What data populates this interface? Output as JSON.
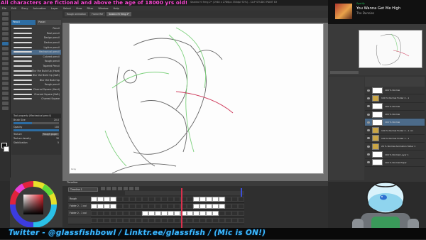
{
  "banner": "All characters are fictional and above the age of 18000 yrs old!",
  "app_title": "Seadra Hi frmg 2* (1948 x 2786px 350dpi 92%) - CLIP STUDIO PAINT EX",
  "menu": [
    "File",
    "Edit",
    "Story",
    "Animation",
    "Layer",
    "Select",
    "View",
    "Filter",
    "Window",
    "Help"
  ],
  "sub_tool_tabs": [
    "Pencil",
    "Pastel"
  ],
  "brushes": [
    {
      "label": "Pencil"
    },
    {
      "label": "Real pencil"
    },
    {
      "label": "Design pencil"
    },
    {
      "label": "Darker pencil"
    },
    {
      "label": "Lighter pencil"
    },
    {
      "label": "Mechanical pencil"
    },
    {
      "label": "Colored pencil"
    },
    {
      "label": "Rough pencil"
    },
    {
      "label": "Tapered Pencil"
    },
    {
      "label": "Blur the Build Up (Hard)"
    },
    {
      "label": "Blur the Build Up (Soft)"
    },
    {
      "label": "Blur the Build Up"
    },
    {
      "label": "Rough pencil"
    },
    {
      "label": "Charred Square (Hard)"
    },
    {
      "label": "Charred Square (Soft)"
    },
    {
      "label": "Charred Square"
    }
  ],
  "tool_property": {
    "header": "Tool property (Mechanical pencil)",
    "brush_size_label": "Brush Size",
    "brush_size": "20.0",
    "opacity_label": "Opacity",
    "opacity": "100",
    "opacity_fraction": 1.0,
    "texture_label": "Texture",
    "texture_value": "Rough paper",
    "texture_density_label": "Texture density",
    "texture_density": "30",
    "stabilization_label": "Stabilization",
    "stabilization": "5"
  },
  "doc_tabs": [
    "Rough animation",
    "Frame Ref",
    "Seadra Hi frmg 2*"
  ],
  "canvas_label": "Grey",
  "timeline": {
    "title": "Timeline",
    "selector": "Timeline 1",
    "tracks": [
      {
        "name": "Rough",
        "cells": [
          1,
          1,
          1,
          1,
          0,
          0,
          0,
          0,
          0,
          0,
          0,
          0,
          0,
          0,
          0,
          0,
          1,
          1,
          1,
          1,
          1,
          0,
          0,
          0
        ]
      },
      {
        "name": "Folder 2 - 1 col",
        "cells": [
          1,
          1,
          1,
          1,
          0,
          0,
          0,
          0,
          0,
          0,
          0,
          0,
          0,
          0,
          0,
          0,
          1,
          1,
          1,
          1,
          1,
          0,
          0,
          0
        ]
      },
      {
        "name": "Folder 2 - 1 col",
        "cells": [
          0,
          0,
          0,
          0,
          0,
          0,
          0,
          0,
          1,
          1,
          1,
          1,
          1,
          1,
          1,
          1,
          1,
          1,
          1,
          1,
          0,
          0,
          0,
          0
        ]
      },
      {
        "name": "",
        "cells": [
          0,
          0,
          0,
          0,
          0,
          0,
          0,
          0,
          0,
          0,
          0,
          0,
          0,
          0,
          0,
          0,
          0,
          0,
          0,
          0,
          0,
          0,
          0,
          0
        ]
      }
    ]
  },
  "spotify": {
    "app_name": "Spotify",
    "song": "You Wanna Get Me High",
    "artist": "The Dunnies"
  },
  "layers": [
    {
      "name": "100 % Normal"
    },
    {
      "name": "100 % Normal Folder 2 - 1"
    },
    {
      "name": "100 % Normal"
    },
    {
      "name": "100 % Normal"
    },
    {
      "name": "100 % Normal",
      "selected": true
    },
    {
      "name": "100 % Normal Folder 2 - 1 col"
    },
    {
      "name": "100 % Normal Folder 1 - 1"
    },
    {
      "name": "26 % Normal Animation folder 1"
    },
    {
      "name": "100 % Normal Layer 1"
    },
    {
      "name": "100 % Normal Paper"
    }
  ],
  "social_bar": "Twitter - @glassfishbowl / Linktr.ee/glassfish / (Mic is ON!)",
  "colors": {
    "banner": "#ff4bd8",
    "social": "#3bb9ff",
    "selection": "#4c6b8a",
    "accent": "#2d6da3",
    "playhead": "#d9304c"
  }
}
